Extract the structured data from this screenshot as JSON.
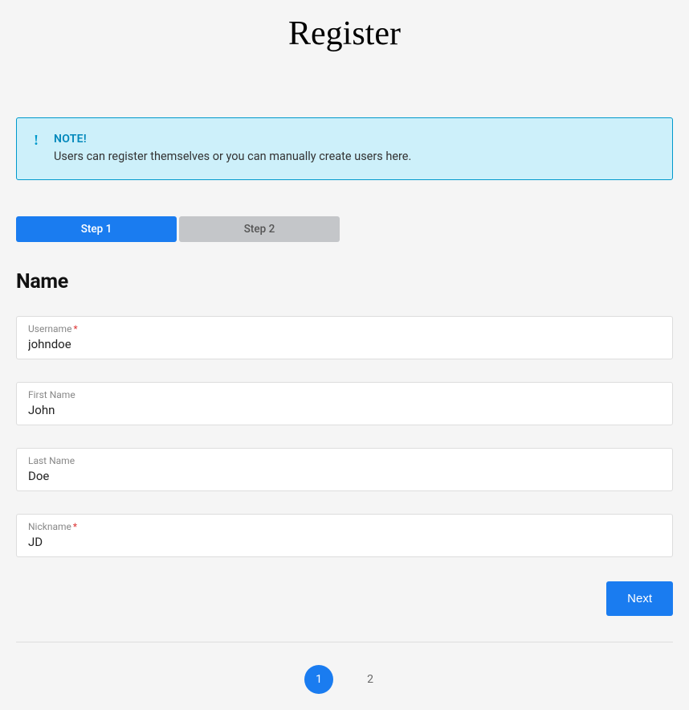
{
  "page": {
    "title": "Register"
  },
  "note": {
    "title": "NOTE!",
    "text": "Users can register themselves or you can manually create users here."
  },
  "steps": {
    "step1": "Step 1",
    "step2": "Step 2"
  },
  "section": {
    "heading": "Name"
  },
  "fields": {
    "username": {
      "label": "Username",
      "required": "*",
      "value": "johndoe"
    },
    "firstname": {
      "label": "First Name",
      "value": "John"
    },
    "lastname": {
      "label": "Last Name",
      "value": "Doe"
    },
    "nickname": {
      "label": "Nickname",
      "required": "*",
      "value": "JD"
    }
  },
  "actions": {
    "next": "Next"
  },
  "pagination": {
    "page1": "1",
    "page2": "2"
  }
}
